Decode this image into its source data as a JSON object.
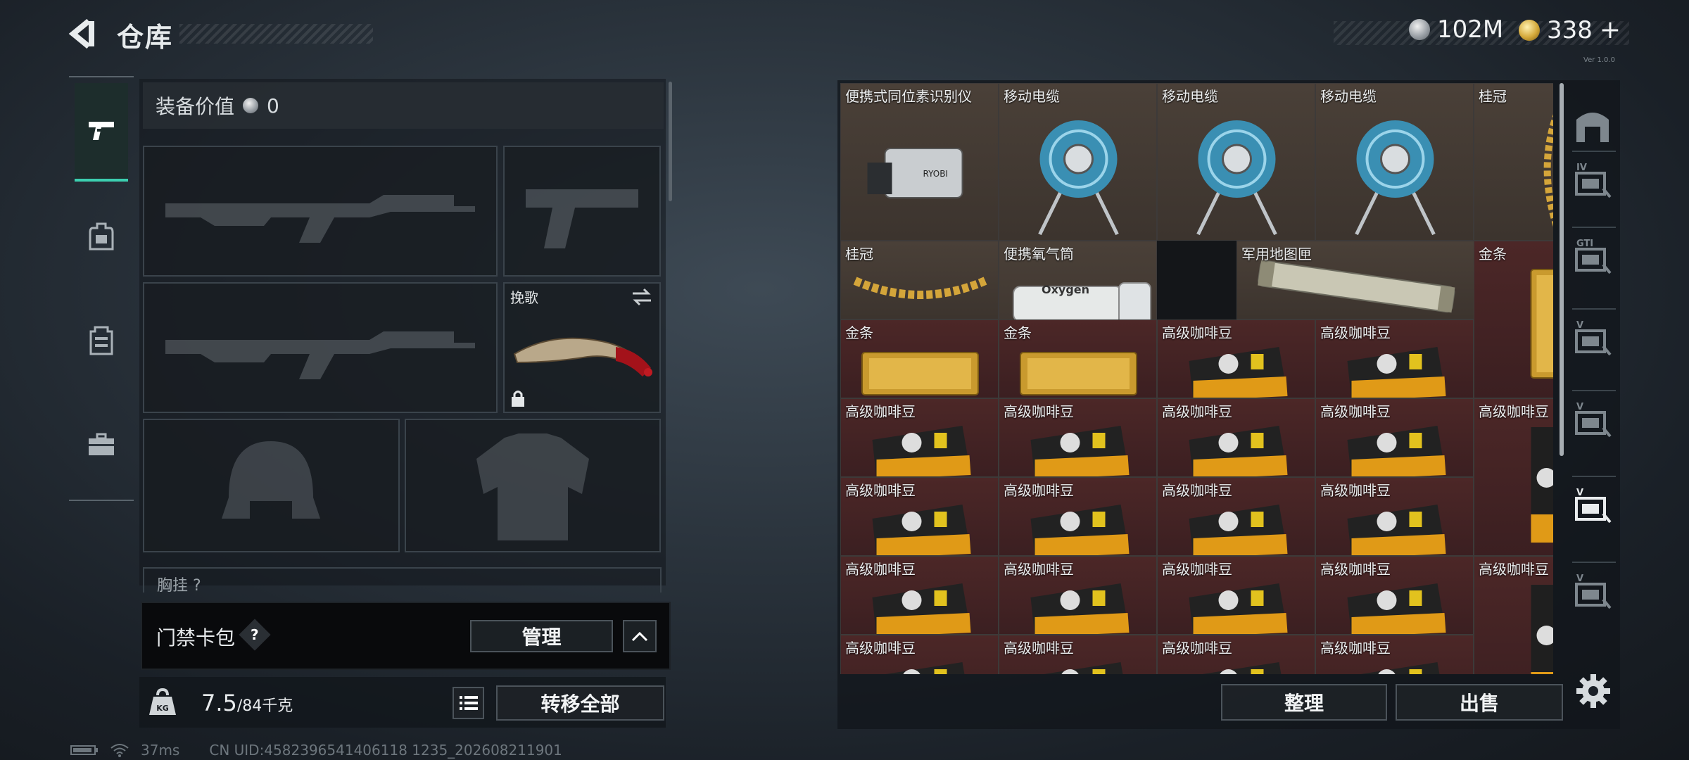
{
  "header": {
    "title": "仓库",
    "currency": [
      {
        "icon": "silver-coin-icon",
        "value": "102M"
      },
      {
        "icon": "gold-coin-icon",
        "value": "338"
      }
    ],
    "add_symbol": "+",
    "version": "Ver 1.0.0"
  },
  "left_nav": {
    "tabs": [
      {
        "name": "weapons",
        "icon": "pistol-icon"
      },
      {
        "name": "backpack",
        "icon": "backpack-icon"
      },
      {
        "name": "vest",
        "icon": "vest-icon"
      },
      {
        "name": "case",
        "icon": "briefcase-icon"
      }
    ]
  },
  "loadout": {
    "equip_value_label": "装备价值",
    "equip_value": "0",
    "melee_slot_label": "挽歌",
    "chest_label": "胸挂",
    "chest_q": "?",
    "keycard_label": "门禁卡包",
    "keycard_help": "?",
    "manage_label": "管理",
    "weight_current": "7.5",
    "weight_max": "/84千克",
    "transfer_all_label": "转移全部"
  },
  "storage": {
    "items": [
      {
        "name": "便携式同位素识别仪",
        "bg": "brown",
        "kind": "isotope"
      },
      {
        "name": "移动电缆",
        "bg": "brown",
        "kind": "reel"
      },
      {
        "name": "移动电缆",
        "bg": "brown",
        "kind": "reel"
      },
      {
        "name": "移动电缆",
        "bg": "brown",
        "kind": "reel"
      },
      {
        "name": "桂冠",
        "bg": "brown",
        "kind": "laurel-v"
      },
      {
        "name": "桂冠",
        "bg": "brown",
        "kind": "laurel-h"
      },
      {
        "name": "便携氧气筒",
        "bg": "brown",
        "kind": "oxygen"
      },
      {
        "name": "军用地图匣",
        "bg": "brown",
        "kind": "maptube"
      },
      {
        "name": "金条",
        "bg": "red",
        "kind": "goldbar-v"
      },
      {
        "name": "金条",
        "bg": "red",
        "kind": "goldbar"
      },
      {
        "name": "金条",
        "bg": "red",
        "kind": "goldbar"
      },
      {
        "name": "高级咖啡豆",
        "bg": "red",
        "kind": "coffee"
      },
      {
        "name": "高级咖啡豆",
        "bg": "red",
        "kind": "coffee"
      },
      {
        "name": "高级咖啡豆",
        "bg": "red",
        "kind": "coffee"
      },
      {
        "name": "高级咖啡豆",
        "bg": "red",
        "kind": "coffee"
      },
      {
        "name": "高级咖啡豆",
        "bg": "red",
        "kind": "coffee"
      },
      {
        "name": "高级咖啡豆",
        "bg": "red",
        "kind": "coffee"
      },
      {
        "name": "高级咖啡豆",
        "bg": "red",
        "kind": "coffee-v"
      },
      {
        "name": "高级咖啡豆",
        "bg": "red",
        "kind": "coffee"
      },
      {
        "name": "高级咖啡豆",
        "bg": "red",
        "kind": "coffee"
      },
      {
        "name": "高级咖啡豆",
        "bg": "red",
        "kind": "coffee"
      },
      {
        "name": "高级咖啡豆",
        "bg": "red",
        "kind": "coffee"
      },
      {
        "name": "高级咖啡豆",
        "bg": "red",
        "kind": "coffee"
      },
      {
        "name": "高级咖啡豆",
        "bg": "red",
        "kind": "coffee"
      },
      {
        "name": "高级咖啡豆",
        "bg": "red",
        "kind": "coffee"
      },
      {
        "name": "高级咖啡豆",
        "bg": "red",
        "kind": "coffee"
      },
      {
        "name": "高级咖啡豆",
        "bg": "red",
        "kind": "coffee-v"
      },
      {
        "name": "高级咖啡豆",
        "bg": "red",
        "kind": "coffee"
      },
      {
        "name": "高级咖啡豆",
        "bg": "red",
        "kind": "coffee"
      },
      {
        "name": "高级咖啡豆",
        "bg": "red",
        "kind": "coffee"
      },
      {
        "name": "高级咖啡豆",
        "bg": "red",
        "kind": "coffee"
      }
    ],
    "sort_label": "整理",
    "sell_label": "出售"
  },
  "right_nav": {
    "icons": [
      "safe-box-icon",
      "case-iv-icon",
      "case-gti-icon",
      "case-v-icon",
      "case-v-icon",
      "case-v-selected-icon",
      "case-v-icon"
    ]
  },
  "status_bar": {
    "ping": "37ms",
    "uid": "CN UID:4582396541406118 1235_202608211901"
  }
}
